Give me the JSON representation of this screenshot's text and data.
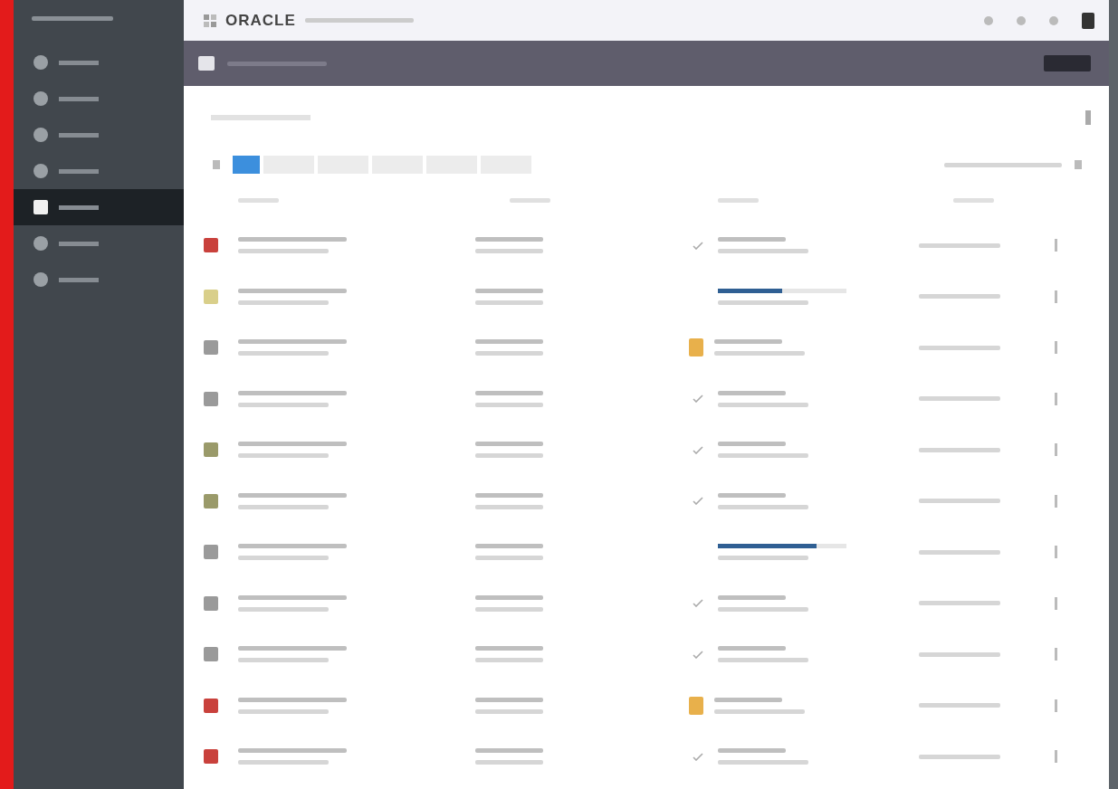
{
  "header": {
    "logo": "ORACLE"
  },
  "sidebar": {
    "items": [
      {
        "selected": false
      },
      {
        "selected": false
      },
      {
        "selected": false
      },
      {
        "selected": false
      },
      {
        "selected": true
      },
      {
        "selected": false
      },
      {
        "selected": false
      }
    ]
  },
  "filter_tabs": [
    {
      "selected": true
    },
    {
      "selected": false
    },
    {
      "selected": false
    },
    {
      "selected": false
    },
    {
      "selected": false
    },
    {
      "selected": false
    }
  ],
  "rows": [
    {
      "color": "#c9413c",
      "kind": "completed"
    },
    {
      "color": "#d9cf8a",
      "kind": "running",
      "level": 0.5
    },
    {
      "color": "#9a9a9a",
      "kind": "warning"
    },
    {
      "color": "#9a9a9a",
      "kind": "completed"
    },
    {
      "color": "#9a9a6a",
      "kind": "completed"
    },
    {
      "color": "#9a9a6a",
      "kind": "completed"
    },
    {
      "color": "#9a9a9a",
      "kind": "running",
      "level": 0.77
    },
    {
      "color": "#9a9a9a",
      "kind": "completed"
    },
    {
      "color": "#9a9a9a",
      "kind": "completed"
    },
    {
      "color": "#c9413c",
      "kind": "warning"
    },
    {
      "color": "#c9413c",
      "kind": "completed"
    }
  ]
}
